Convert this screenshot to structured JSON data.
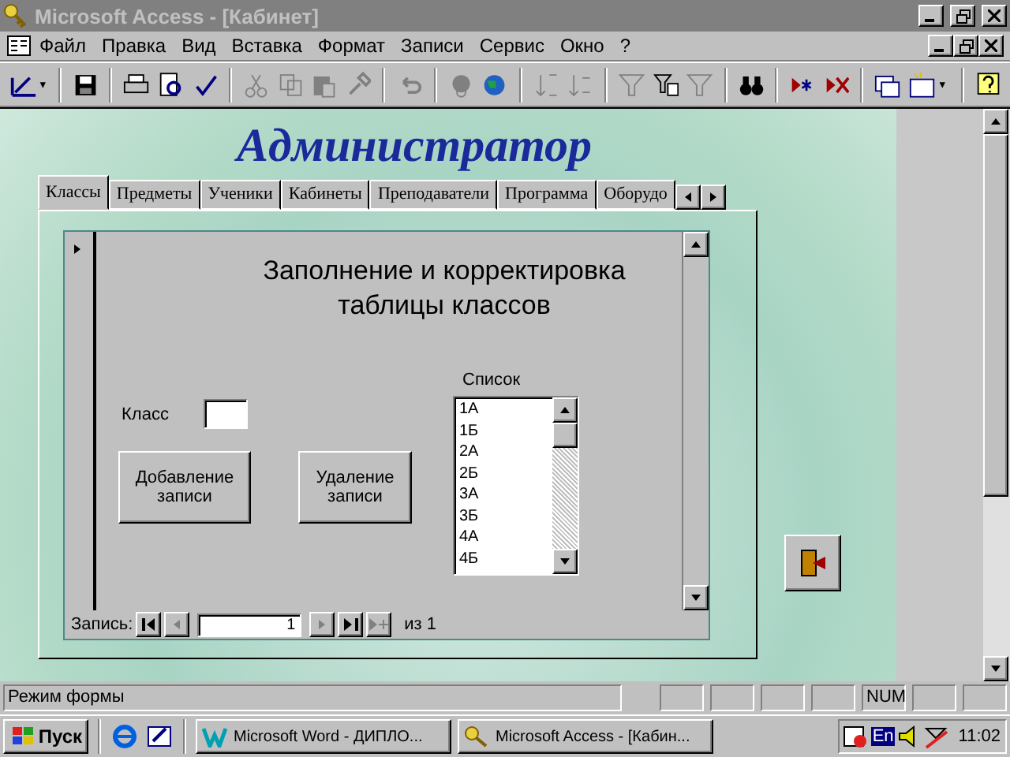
{
  "window": {
    "title": "Microsoft Access - [Кабинет]"
  },
  "menu": [
    "Файл",
    "Правка",
    "Вид",
    "Вставка",
    "Формат",
    "Записи",
    "Сервис",
    "Окно",
    "?"
  ],
  "form": {
    "title": "Администратор",
    "tabs": [
      {
        "label": "Классы",
        "selected": true
      },
      {
        "label": "Предметы",
        "selected": false
      },
      {
        "label": "Ученики",
        "selected": false
      },
      {
        "label": "Кабинеты",
        "selected": false
      },
      {
        "label": "Преподаватели",
        "selected": false
      },
      {
        "label": "Программа",
        "selected": false
      },
      {
        "label": "Оборудо",
        "selected": false
      }
    ],
    "subform": {
      "heading": "Заполнение и корректировка таблицы классов",
      "field": {
        "label": "Класс"
      },
      "buttons": [
        "Добавление записи",
        "Удаление записи"
      ],
      "list": {
        "label": "Список",
        "items": [
          "1А",
          "1Б",
          "2А",
          "2Б",
          "3А",
          "3Б",
          "4А",
          "4Б"
        ]
      },
      "navigator": {
        "label": "Запись:",
        "current": "1",
        "total": "из 1"
      }
    }
  },
  "status_bar": {
    "text": "Режим формы",
    "indicator": "NUM"
  },
  "taskbar": {
    "start": "Пуск",
    "tasks": [
      "Microsoft Word - ДИПЛО...",
      "Microsoft Access - [Кабин..."
    ],
    "language": "En",
    "clock": "11:02"
  }
}
